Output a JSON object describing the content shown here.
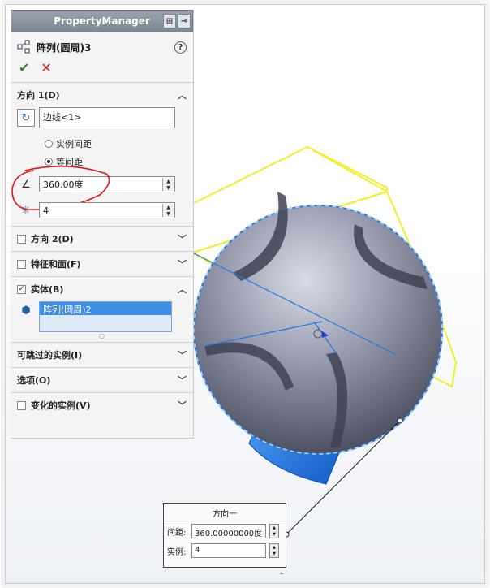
{
  "property_manager": {
    "tab_title": "PropertyManager",
    "feature_title": "阵列(圆周)3",
    "help_label": "?",
    "ok_label": "✔",
    "cancel_label": "✕",
    "direction1": {
      "title": "方向 1(D)",
      "edge_value": "边线<1>",
      "radio_instance_spacing": "实例间距",
      "radio_equal_spacing": "等间距",
      "angle_value": "360.00度",
      "count_value": "4"
    },
    "direction2": {
      "title": "方向 2(D)"
    },
    "features_faces": {
      "title": "特征和面(F)"
    },
    "bodies": {
      "title": "实体(B)",
      "selected_item": "阵列(圆周)2"
    },
    "skip_instances": {
      "title": "可跳过的实例(I)"
    },
    "options": {
      "title": "选项(O)"
    },
    "varied_instances": {
      "title": "变化的实例(V)"
    }
  },
  "callout": {
    "title": "方向一",
    "spacing_label": "间距:",
    "spacing_value": "360.00000000度",
    "instances_label": "实例:",
    "instances_value": "4"
  },
  "colors": {
    "preview_yellow": "#f2ee2a",
    "selection_blue": "#1f78e0",
    "annotation_red": "#e0161b",
    "ball_gray": "#8a8ea0"
  }
}
